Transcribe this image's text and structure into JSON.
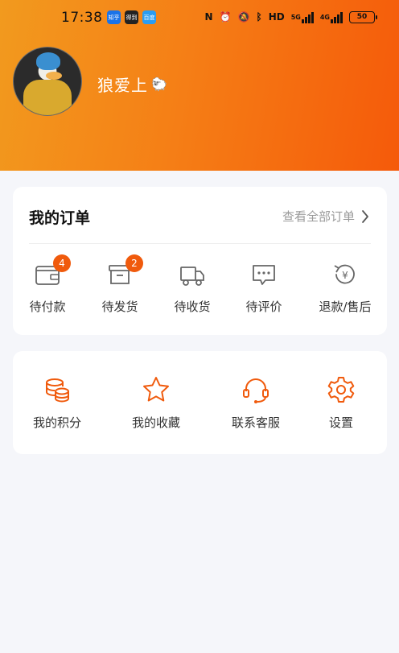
{
  "status_bar": {
    "time": "17:38",
    "app_badges": [
      "知乎",
      "得到",
      "百度"
    ],
    "network_5g": "5G",
    "network_4g": "4G",
    "hd_label": "HD",
    "battery": "50"
  },
  "profile": {
    "username": "狼爱上",
    "emoji": "🐑"
  },
  "orders": {
    "title": "我的订单",
    "view_all": "查看全部订单",
    "items": [
      {
        "label": "待付款",
        "badge": "4",
        "icon": "wallet-icon"
      },
      {
        "label": "待发货",
        "badge": "2",
        "icon": "box-icon"
      },
      {
        "label": "待收货",
        "badge": "",
        "icon": "truck-icon"
      },
      {
        "label": "待评价",
        "badge": "",
        "icon": "comment-icon"
      },
      {
        "label": "退款/售后",
        "badge": "",
        "icon": "refund-icon"
      }
    ]
  },
  "services": {
    "items": [
      {
        "label": "我的积分",
        "icon": "coins-icon"
      },
      {
        "label": "我的收藏",
        "icon": "star-icon"
      },
      {
        "label": "联系客服",
        "icon": "headset-icon"
      },
      {
        "label": "设置",
        "icon": "gear-icon"
      }
    ]
  },
  "colors": {
    "accent": "#f05a0c",
    "header_start": "#f29a1e",
    "header_end": "#f55a0a"
  }
}
